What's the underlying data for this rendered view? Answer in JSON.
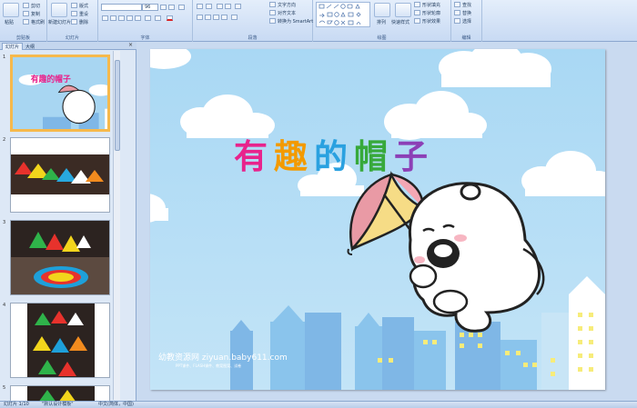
{
  "ribbon": {
    "clipboard": {
      "label": "剪贴板",
      "paste": "粘贴",
      "cut": "剪切",
      "copy": "复制",
      "format_painter": "格式刷"
    },
    "slides": {
      "label": "幻灯片",
      "new_slide": "新建幻灯片",
      "layout": "版式",
      "reset": "重设",
      "delete": "删除"
    },
    "font": {
      "label": "字体",
      "font_name": "",
      "font_size": "96"
    },
    "paragraph": {
      "label": "段落",
      "text_direction": "文字方向",
      "align_text": "对齐文本",
      "smartart": "转换为 SmartArt"
    },
    "drawing": {
      "label": "绘图",
      "arrange": "排列",
      "quick_styles": "快速样式",
      "shape_fill": "形状填充",
      "shape_outline": "形状轮廓",
      "shape_effects": "形状效果"
    },
    "editing": {
      "label": "编辑",
      "find": "查找",
      "replace": "替换",
      "select": "选择"
    }
  },
  "left_panel": {
    "tab_slides": "幻灯片",
    "tab_outline": "大纲",
    "close": "×",
    "slides": [
      {
        "num": "1",
        "title": "有趣的帽子"
      },
      {
        "num": "2"
      },
      {
        "num": "3"
      },
      {
        "num": "4"
      },
      {
        "num": "5"
      }
    ]
  },
  "slide": {
    "title_chars": [
      "有",
      "趣",
      "的",
      "帽",
      "子"
    ],
    "title_colors": [
      "#e8238c",
      "#f39a00",
      "#2aa1e0",
      "#37a93b",
      "#8c3fb6"
    ],
    "credit": "幼教资源网 ziyuan.baby611.com",
    "credit_sub": "PPT课件、FLASH课件、教案图案、试卷"
  },
  "status": {
    "slide_count": "幻灯片 1/10",
    "theme": "\"默认设计模板\"",
    "language": "中文(简体，中国)"
  }
}
